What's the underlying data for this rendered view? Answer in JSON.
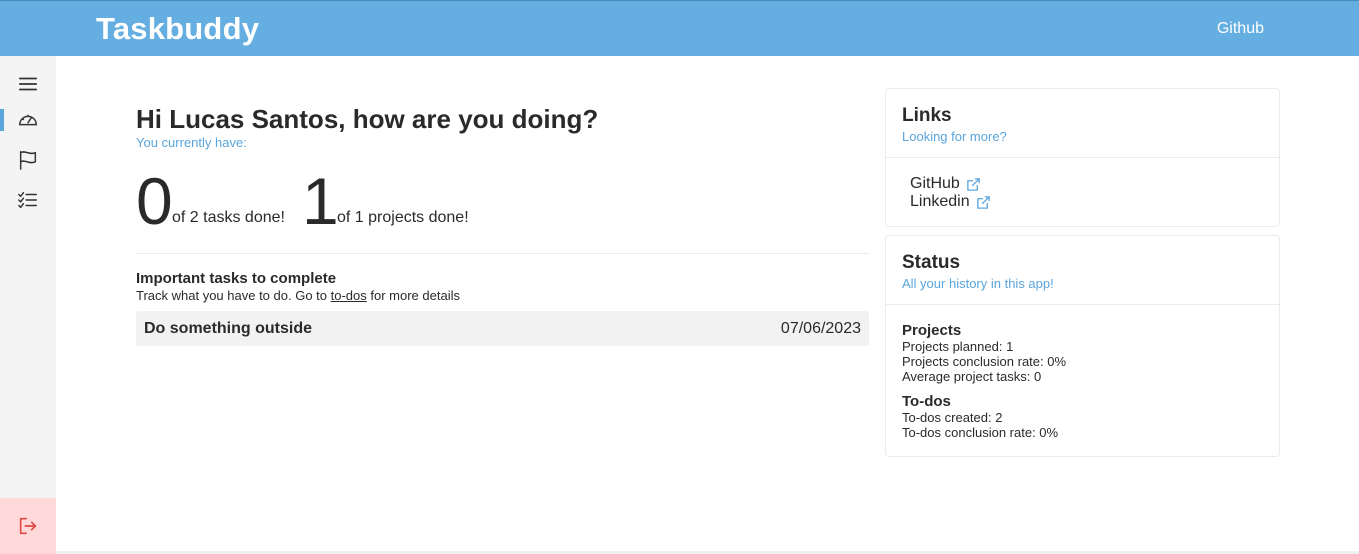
{
  "header": {
    "brand": "Taskbuddy",
    "github_label": "Github"
  },
  "sidebar": {
    "items": [
      {
        "icon": "menu-icon"
      },
      {
        "icon": "dashboard-gauge-icon",
        "active": true
      },
      {
        "icon": "flag-icon"
      },
      {
        "icon": "checklist-icon"
      }
    ],
    "logout_icon": "logout-icon"
  },
  "main": {
    "greeting": "Hi Lucas Santos, how are you doing?",
    "subline": "You currently have:",
    "tasks_done": "0",
    "tasks_text": "of 2 tasks done!",
    "projects_done": "1",
    "projects_text": "of 1 projects done!",
    "important_title": "Important tasks to complete",
    "important_sub_before": "Track what you have to do. Go to ",
    "important_sub_link": "to-dos",
    "important_sub_after": " for more details",
    "tasks": [
      {
        "name": "Do something outside",
        "date": "07/06/2023"
      }
    ]
  },
  "links_card": {
    "title": "Links",
    "subtitle": "Looking for more?",
    "items": [
      {
        "label": "GitHub",
        "icon": "external-link-icon"
      },
      {
        "label": "Linkedin",
        "icon": "external-link-icon"
      }
    ]
  },
  "status_card": {
    "title": "Status",
    "subtitle": "All your history in this app!",
    "projects": {
      "title": "Projects",
      "lines": [
        "Projects planned: 1",
        "Projects conclusion rate: 0%",
        "Average project tasks: 0"
      ]
    },
    "todos": {
      "title": "To-dos",
      "lines": [
        "To-dos created: 2",
        "To-dos conclusion rate: 0%"
      ]
    }
  },
  "colors": {
    "header_bg": "#64aee1",
    "accent": "#5aa5dc",
    "logout_bg": "#ffd9d9",
    "logout_icon": "#e04848"
  }
}
